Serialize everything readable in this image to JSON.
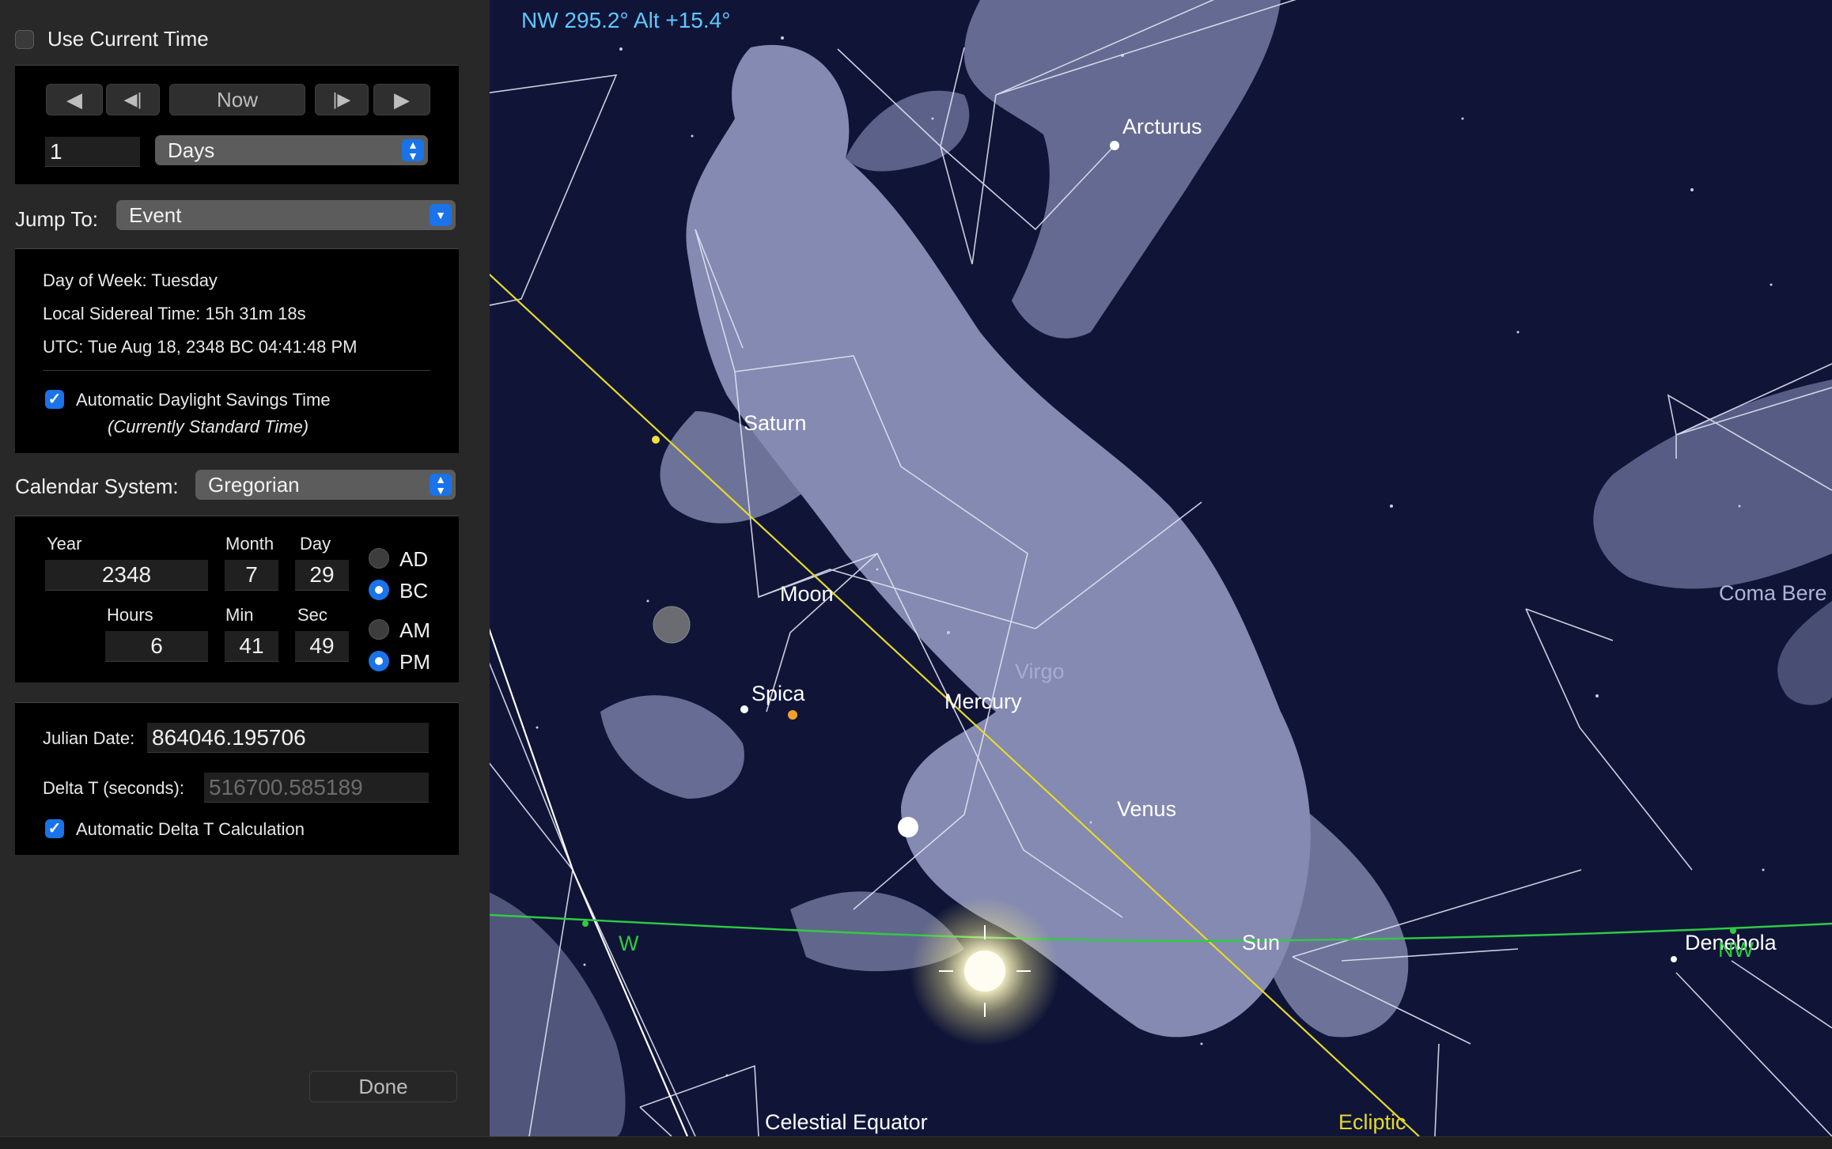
{
  "panel": {
    "use_current_time": {
      "label": "Use Current Time",
      "checked": false
    },
    "time_controls": {
      "rewind_icon": "◀",
      "step_back_icon": "◀|",
      "now_label": "Now",
      "step_forward_icon": "|▶",
      "play_icon": "▶",
      "step_value": "1",
      "step_unit": "Days"
    },
    "jump_to": {
      "label": "Jump To:",
      "value": "Event"
    },
    "info": {
      "day_of_week": "Day of Week:  Tuesday",
      "sidereal": "Local Sidereal Time:  15h 31m 18s",
      "utc": "UTC:  Tue Aug 18, 2348 BC 04:41:48 PM",
      "dst_label": "Automatic Daylight Savings Time",
      "dst_note": "(Currently Standard Time)",
      "dst_checked": true
    },
    "calendar": {
      "label": "Calendar System:",
      "value": "Gregorian"
    },
    "date": {
      "year_label": "Year",
      "year": "2348",
      "month_label": "Month",
      "month": "7",
      "day_label": "Day",
      "day": "29",
      "ad_label": "AD",
      "bc_label": "BC",
      "era_selected": "BC",
      "hours_label": "Hours",
      "hours": "6",
      "min_label": "Min",
      "min": "41",
      "sec_label": "Sec",
      "sec": "49",
      "am_label": "AM",
      "pm_label": "PM",
      "period_selected": "PM"
    },
    "julian": {
      "label": "Julian Date:",
      "value": "864046.195706",
      "delta_label": "Delta T (seconds):",
      "delta_value": "516700.585189",
      "auto_delta_label": "Automatic Delta T Calculation",
      "auto_delta_checked": true
    },
    "done_label": "Done"
  },
  "sky": {
    "readout": "NW 295.2° Alt +15.4°",
    "labels": {
      "arcturus": "Arcturus",
      "saturn": "Saturn",
      "moon": "Moon",
      "spica": "Spica",
      "mercury": "Mercury",
      "virgo": "Virgo",
      "venus": "Venus",
      "sun": "Sun",
      "denebola": "Denebola",
      "coma": "Coma Bere",
      "west": "W",
      "northwest": "NW",
      "celestial_equator": "Celestial Equator",
      "ecliptic": "Ecliptic"
    },
    "colors": {
      "background": "#101538",
      "constellation_art": "#9aa0c8",
      "ecliptic": "#e6d92a",
      "horizon": "#2ecc40",
      "readout": "#5ec8ff",
      "sun": "#fffbe0"
    }
  }
}
